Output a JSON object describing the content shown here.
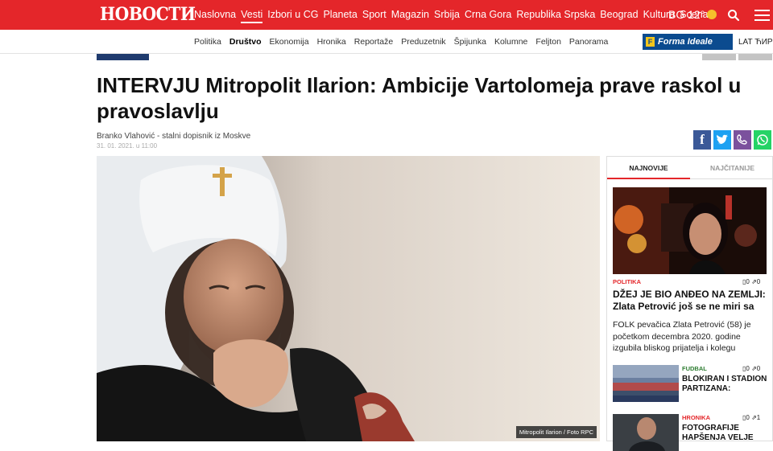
{
  "header": {
    "logo": "НОВОСТИ",
    "nav": [
      "Naslovna",
      "Vesti",
      "Izbori u CG",
      "Planeta",
      "Sport",
      "Magazin",
      "Srbija",
      "Crna Gora",
      "Republika Srpska",
      "Beograd",
      "Kultura",
      "Scena"
    ],
    "active_nav": "Vesti",
    "weather": "BG 12°"
  },
  "subnav": {
    "items": [
      "Politika",
      "Društvo",
      "Ekonomija",
      "Hronika",
      "Reportaže",
      "Preduzetnik",
      "Špijunka",
      "Kolumne",
      "Feljton",
      "Panorama"
    ],
    "active": "Društvo",
    "sponsor": "Forma Ideale",
    "script_toggle": "LAT ЋИР"
  },
  "article": {
    "title": "INTERVJU Mitropolit Ilarion: Ambicije Vartolomeja prave raskol u pravoslavlju",
    "author": "Branko Vlahović - stalni dopisnik iz Moskve",
    "date": "31. 01. 2021. u 11:00",
    "photo_caption": "Mitropolit Ilarion / Foto RPC"
  },
  "share": [
    {
      "name": "facebook",
      "glyph": "f",
      "color": "#3b5998"
    },
    {
      "name": "twitter",
      "glyph": "t",
      "color": "#1da1f2"
    },
    {
      "name": "viber",
      "glyph": "v",
      "color": "#7b519d"
    },
    {
      "name": "whatsapp",
      "glyph": "w",
      "color": "#25d366"
    }
  ],
  "sidebar": {
    "tab_latest": "NAJNOVIJE",
    "tab_popular": "NAJČITANIJE",
    "featured": {
      "category": "POLITIKA",
      "comments": "0",
      "shares": "0",
      "title": "DŽEJ JE BIO ANĐEO NA ZEMLJI: Zlata Petrović još se ne miri sa",
      "lead": "FOLK pevačica Zlata Petrović (58) je početkom decembra 2020. godine izgubila bliskog prijatelja i kolegu"
    },
    "items": [
      {
        "category": "FUDBAL",
        "comments": "0",
        "shares": "0",
        "title": "BLOKIRAN I STADION PARTIZANA:"
      },
      {
        "category": "HRONIKA",
        "comments": "0",
        "shares": "1",
        "title": "FOTOGRAFIJE HAPŠENJA VELJE"
      }
    ]
  },
  "colors": {
    "brand_red": "#e4262a",
    "category_red": "#e4262a",
    "category_green": "#2e7d32"
  }
}
